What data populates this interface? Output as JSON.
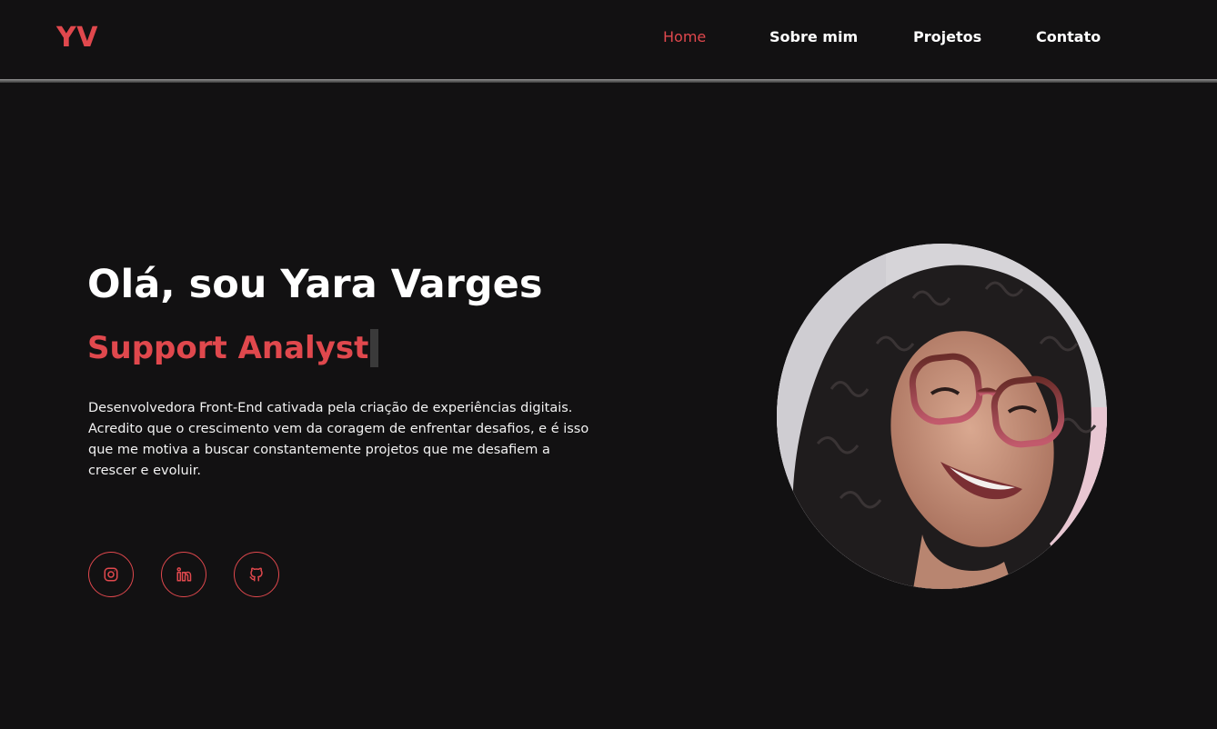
{
  "header": {
    "logo": "YV",
    "nav": [
      {
        "label": "Home",
        "active": true
      },
      {
        "label": "Sobre mim",
        "active": false
      },
      {
        "label": "Projetos",
        "active": false
      },
      {
        "label": "Contato",
        "active": false
      }
    ]
  },
  "hero": {
    "title": "Olá, sou Yara Varges",
    "role": "Support Analyst",
    "bio": "Desenvolvedora Front-End cativada pela criação de experiências digitais. Acredito que o crescimento vem da coragem de enfrentar desafios, e é isso que me motiva a buscar constantemente projetos que me desafiem a crescer e evoluir.",
    "socials": [
      {
        "icon": "instagram-icon"
      },
      {
        "icon": "linkedin-icon"
      },
      {
        "icon": "github-icon"
      }
    ]
  },
  "theme": {
    "accent": "#e0484d",
    "background": "#121112",
    "text": "#ffffff"
  }
}
